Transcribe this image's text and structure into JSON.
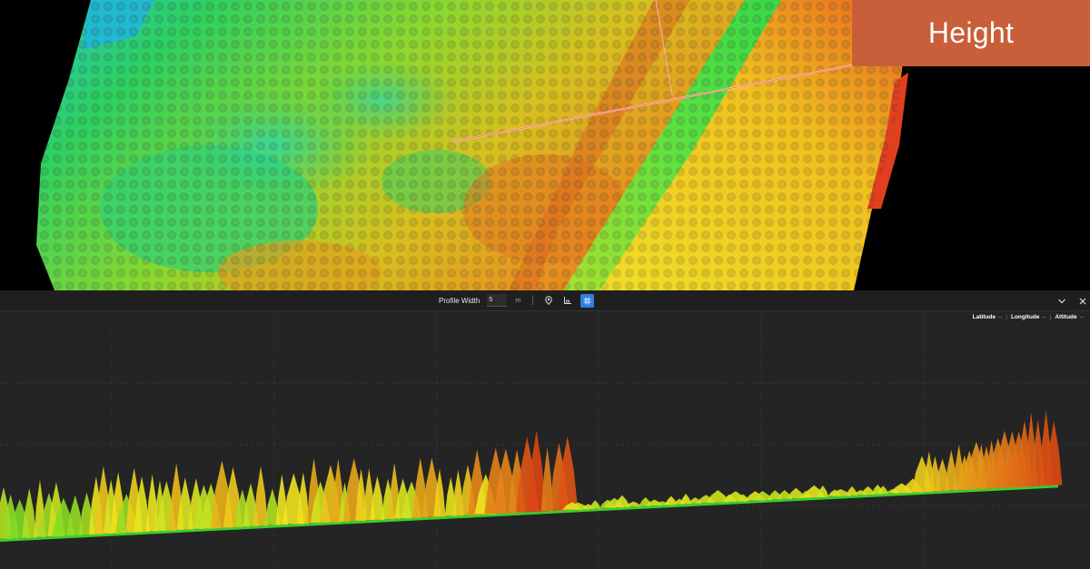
{
  "overlay": {
    "label": "Height",
    "color": "#c95f3a"
  },
  "profile_toolbar": {
    "profile_width_label": "Profile Width",
    "profile_width_value": "5",
    "profile_width_unit": "m",
    "icons": [
      "location-pin-icon",
      "measure-icon",
      "grid-icon",
      "chevron-down-icon",
      "close-icon"
    ]
  },
  "coordinates": {
    "latitude_label": "Latitude",
    "latitude_value": "--",
    "longitude_label": "Longitude",
    "longitude_value": "--",
    "altitude_label": "Altitude",
    "altitude_value": "--"
  },
  "colors": {
    "panel_bg": "#242424",
    "active_blue": "#2f7fe0",
    "low": "#3cd23c",
    "mid": "#f0e020",
    "high": "#e03a1a",
    "water": "#22c8a8"
  }
}
